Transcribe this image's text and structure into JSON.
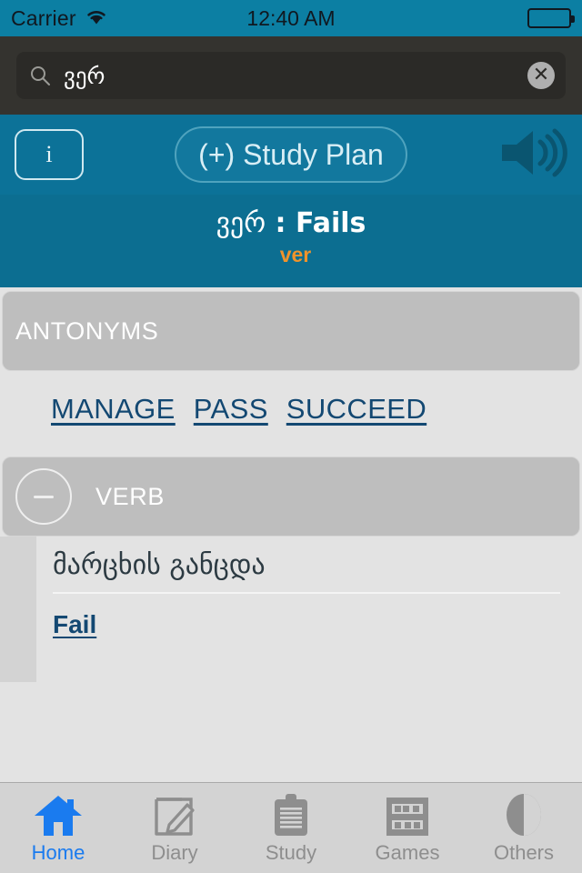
{
  "status_bar": {
    "carrier": "Carrier",
    "wifi_icon": "wifi-icon",
    "time": "12:40 AM",
    "battery_icon": "battery-full-icon"
  },
  "search": {
    "icon": "search-icon",
    "value": "ვერ",
    "placeholder": "",
    "clear_icon": "clear-circle-icon",
    "clear_glyph": "✕"
  },
  "toolbar": {
    "info_label": "i",
    "study_plan_label": "(+) Study Plan",
    "speaker_icon": "speaker-icon"
  },
  "word_header": {
    "term": "ვერ",
    "separator": " : ",
    "translation": "Fails",
    "transliteration": "ver"
  },
  "sections": [
    {
      "heading": "ANTONYMS",
      "links": [
        "MANAGE",
        "PASS",
        "SUCCEED"
      ]
    },
    {
      "heading": "VERB",
      "collapse_icon": "minus-circle-icon",
      "definition": "მარცხის განცდა",
      "link": "Fail"
    }
  ],
  "tabs": [
    {
      "label": "Home",
      "icon": "home-icon",
      "active": true
    },
    {
      "label": "Diary",
      "icon": "note-edit-icon",
      "active": false
    },
    {
      "label": "Study",
      "icon": "clipboard-icon",
      "active": false
    },
    {
      "label": "Games",
      "icon": "abacus-icon",
      "active": false
    },
    {
      "label": "Others",
      "icon": "pie-chart-icon",
      "active": false
    }
  ],
  "colors": {
    "status_teal": "#0C7FA3",
    "toolbar_teal": "#0C7298",
    "header_teal": "#0C6E91",
    "search_dark": "#34332F",
    "link_navy": "#134872",
    "accent_orange": "#F0932B",
    "active_blue": "#1A7BEF",
    "panel_gray": "#BEBEBE",
    "content_gray": "#e3e3e3"
  }
}
